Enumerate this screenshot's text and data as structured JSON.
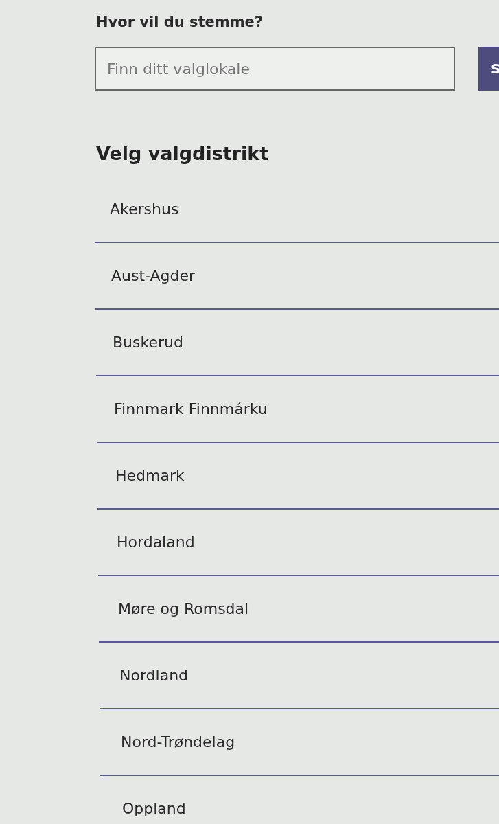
{
  "search": {
    "label": "Hvor vil du stemme?",
    "placeholder": "Finn ditt valglokale",
    "button": "S"
  },
  "districts": {
    "heading": "Velg valgdistrikt",
    "items": [
      {
        "label": "Akershus"
      },
      {
        "label": "Aust-Agder"
      },
      {
        "label": "Buskerud"
      },
      {
        "label": "Finnmark Finnmárku"
      },
      {
        "label": "Hedmark"
      },
      {
        "label": "Hordaland"
      },
      {
        "label": "Møre og Romsdal"
      },
      {
        "label": "Nordland"
      },
      {
        "label": "Nord-Trøndelag"
      },
      {
        "label": "Oppland"
      }
    ]
  }
}
